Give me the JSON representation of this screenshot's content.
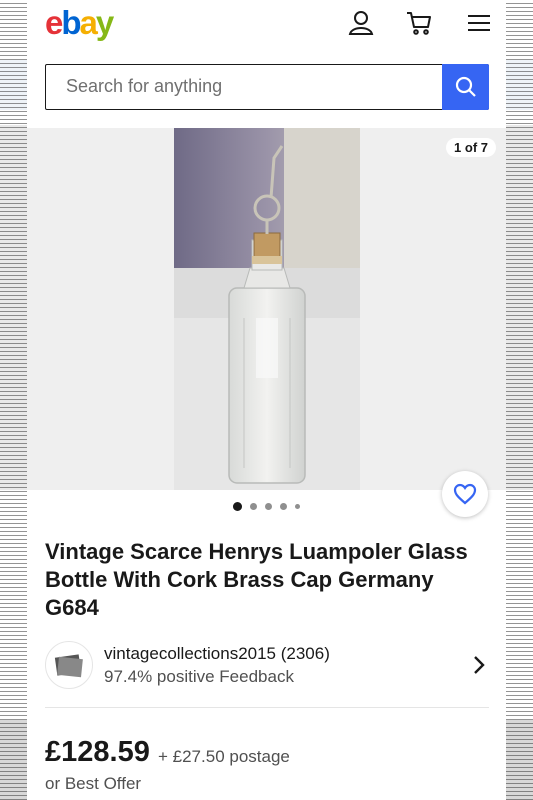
{
  "header": {
    "logo": {
      "letters": [
        "e",
        "b",
        "a",
        "y"
      ],
      "colors": [
        "#e53238",
        "#0064d2",
        "#f5af02",
        "#86b817"
      ]
    },
    "icons": [
      "user-icon",
      "cart-icon",
      "menu-icon"
    ]
  },
  "search": {
    "placeholder": "Search for anything",
    "value": "",
    "button_icon": "search-icon"
  },
  "gallery": {
    "counter": "1 of 7",
    "dots": 5,
    "active_dot": 0
  },
  "listing": {
    "title": "Vintage Scarce Henrys Luampoler Glass Bottle With Cork Brass Cap Germany G684",
    "seller": {
      "name": "vintagecollections2015 (2306)",
      "feedback": "97.4% positive Feedback"
    },
    "price": "£128.59",
    "postage": "+ £27.50 postage",
    "best_offer": "or Best Offer"
  },
  "colors": {
    "accent": "#3665f3",
    "text": "#191919",
    "secondary_text": "#505050"
  }
}
